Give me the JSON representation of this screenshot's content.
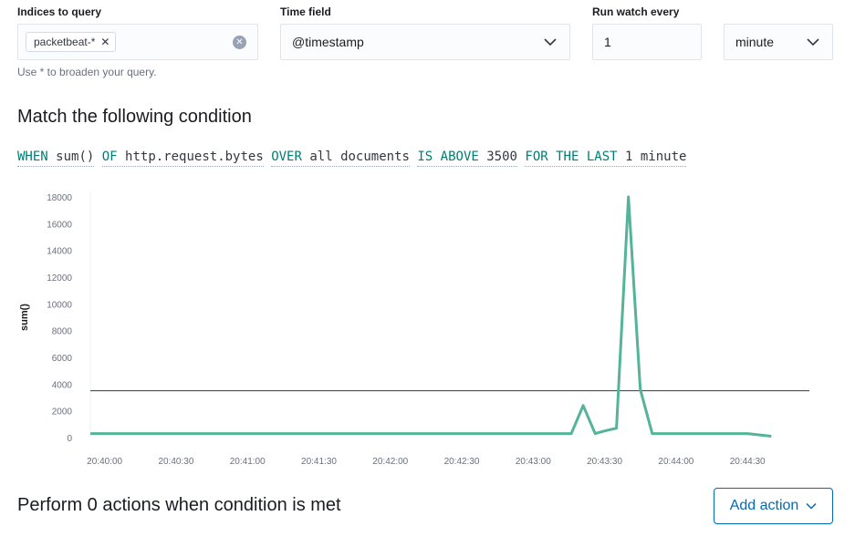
{
  "indices": {
    "label": "Indices to query",
    "selected": [
      "packetbeat-*"
    ],
    "help": "Use * to broaden your query."
  },
  "time_field": {
    "label": "Time field",
    "value": "@timestamp"
  },
  "run_watch": {
    "label": "Run watch every",
    "value": "1",
    "unit": "minute"
  },
  "condition": {
    "title": "Match the following condition",
    "expression": [
      {
        "kw": "WHEN",
        "val": "sum()"
      },
      {
        "kw": "OF",
        "val": "http.request.bytes"
      },
      {
        "kw": "OVER",
        "val": "all documents"
      },
      {
        "kw": "IS ABOVE",
        "val": "3500"
      },
      {
        "kw": "FOR THE LAST",
        "val": "1 minute"
      }
    ]
  },
  "chart_data": {
    "type": "line",
    "ylabel": "sum()",
    "xlabel": "",
    "ylim": [
      0,
      18000
    ],
    "yticks": [
      0,
      2000,
      4000,
      6000,
      8000,
      10000,
      12000,
      14000,
      16000,
      18000
    ],
    "xticks": [
      "20:40:00",
      "20:40:30",
      "20:41:00",
      "20:41:30",
      "20:42:00",
      "20:42:30",
      "20:43:00",
      "20:43:30",
      "20:44:00",
      "20:44:30"
    ],
    "xlim": [
      "20:39:54",
      "20:44:56"
    ],
    "threshold": 3500,
    "color": "#54b399",
    "series": [
      {
        "x": [
          "20:39:54",
          "20:43:02",
          "20:43:07",
          "20:43:11",
          "20:43:16",
          "20:43:21",
          "20:43:26",
          "20:43:30",
          "20:43:35",
          "20:43:40",
          "20:43:45",
          "20:43:50",
          "20:44:00",
          "20:44:30",
          "20:44:40"
        ],
        "y": [
          300,
          300,
          300,
          300,
          300,
          2400,
          300,
          500,
          700,
          18000,
          3600,
          300,
          300,
          300,
          100
        ]
      }
    ],
    "grid": false
  },
  "actions": {
    "title": "Perform 0 actions when condition is met",
    "button_label": "Add action"
  }
}
